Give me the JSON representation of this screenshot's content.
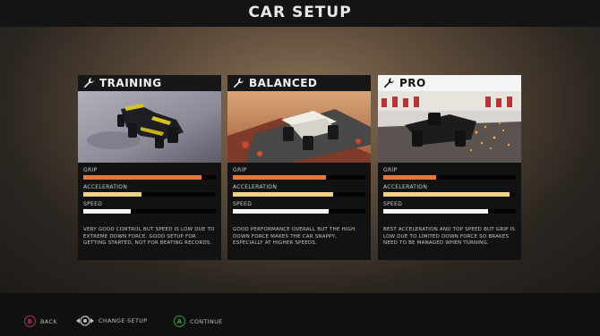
{
  "header": {
    "title": "CAR SETUP"
  },
  "cards": [
    {
      "title": "TRAINING",
      "selected": false,
      "stats": [
        {
          "label": "GRIP",
          "value": 0.89,
          "color": "#e2793a"
        },
        {
          "label": "ACCELERATION",
          "value": 0.44,
          "color": "#f2d27e"
        },
        {
          "label": "SPEED",
          "value": 0.36,
          "color": "#f5f5f5"
        }
      ],
      "description": "VERY GOOD CONTROL BUT SPEED IS LOW DUE TO EXTREME DOWN FORCE. GOOD SETUP FOR GETTING STARTED, NOT FOR BEATING RECORDS."
    },
    {
      "title": "BALANCED",
      "selected": false,
      "stats": [
        {
          "label": "GRIP",
          "value": 0.7,
          "color": "#e2793a"
        },
        {
          "label": "ACCELERATION",
          "value": 0.76,
          "color": "#f2d27e"
        },
        {
          "label": "SPEED",
          "value": 0.72,
          "color": "#f5f5f5"
        }
      ],
      "description": "GOOD PERFORMANCE OVERALL BUT THE HIGH DOWN FORCE MAKES THE CAR SNAPPY, ESPECIALLY AT HIGHER SPEEDS."
    },
    {
      "title": "PRO",
      "selected": true,
      "stats": [
        {
          "label": "GRIP",
          "value": 0.4,
          "color": "#e2793a"
        },
        {
          "label": "ACCELERATION",
          "value": 0.95,
          "color": "#f2d27e"
        },
        {
          "label": "SPEED",
          "value": 0.79,
          "color": "#f5f5f5"
        }
      ],
      "description": "BEST ACCELERATION AND TOP SPEED BUT GRIP IS LOW DUE TO LIMITED DOWN FORCE SO BRAKES NEED TO BE MANAGED WHEN TURNING."
    }
  ],
  "footer": {
    "back": {
      "key": "B",
      "label": "BACK"
    },
    "change": {
      "label": "CHANGE SETUP"
    },
    "continue": {
      "key": "A",
      "label": "CONTINUE"
    }
  }
}
